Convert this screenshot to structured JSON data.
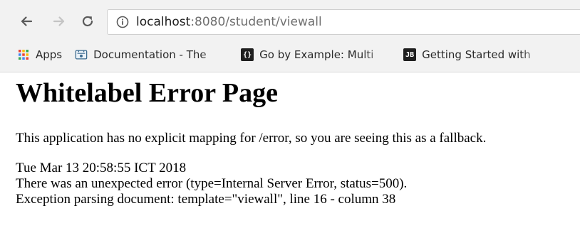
{
  "browser": {
    "back_icon": "back-arrow-icon",
    "forward_icon": "forward-arrow-icon",
    "reload_icon": "reload-icon",
    "site_info_icon": "info-icon",
    "url_host": "localhost",
    "url_rest": ":8080/student/viewall"
  },
  "bookmarks": [
    {
      "label": "Apps",
      "icon": "apps-grid-icon"
    },
    {
      "label": "Documentation - The",
      "icon": "folder-favicon-icon"
    },
    {
      "label": "Go by Example: Multi",
      "icon": "code-braces-icon",
      "icon_text": "{}"
    },
    {
      "label": "Getting Started with",
      "icon": "jetbrains-icon",
      "icon_text": "JB"
    }
  ],
  "page": {
    "title": "Whitelabel Error Page",
    "message": "This application has no explicit mapping for /error, so you are seeing this as a fallback.",
    "timestamp": "Tue Mar 13 20:58:55 ICT 2018",
    "error_line": "There was an unexpected error (type=Internal Server Error, status=500).",
    "exception_line": "Exception parsing document: template=\"viewall\", line 16 - column 38"
  },
  "colors": {
    "chrome_bg": "#f2f2f2",
    "url_host": "#202020",
    "url_rest": "#6f6f6f",
    "forward_disabled": "#c4c4c4"
  }
}
